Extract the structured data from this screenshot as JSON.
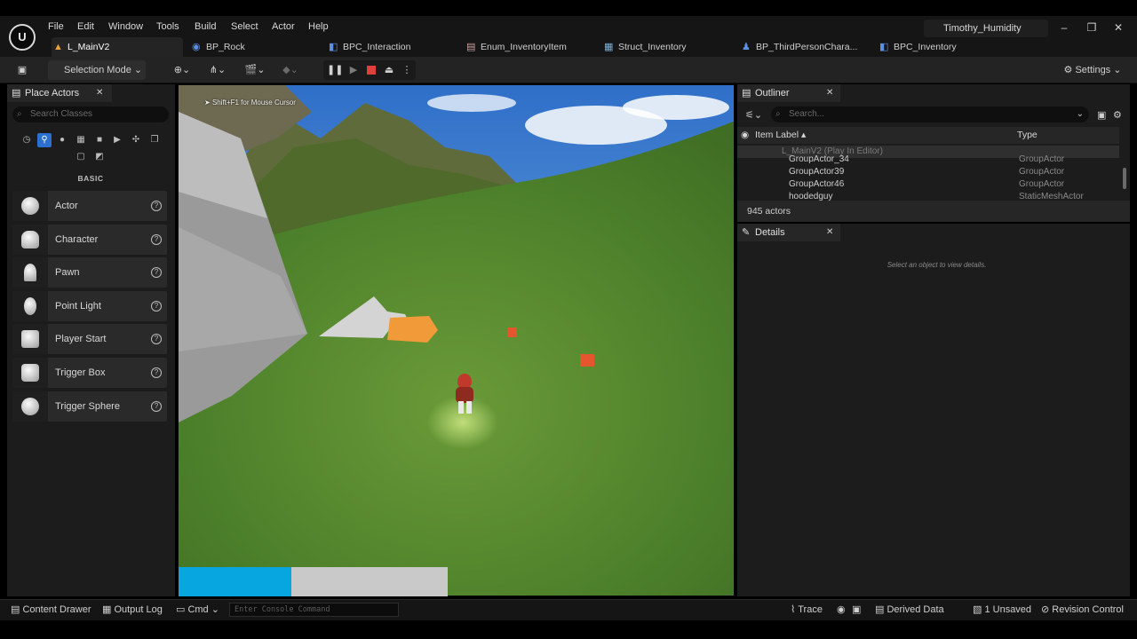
{
  "menu": [
    "File",
    "Edit",
    "Window",
    "Tools",
    "Build",
    "Select",
    "Actor",
    "Help"
  ],
  "user": "Timothy_Humidity",
  "logo_text": "U",
  "tabs": [
    {
      "label": "L_MainV2",
      "icon": "level-icon"
    },
    {
      "label": "BP_Rock",
      "icon": "blueprint-icon"
    },
    {
      "label": "BPC_Interaction",
      "icon": "component-icon"
    },
    {
      "label": "Enum_InventoryItem",
      "icon": "enum-icon"
    },
    {
      "label": "Struct_Inventory",
      "icon": "struct-icon"
    },
    {
      "label": "BP_ThirdPersonChara...",
      "icon": "character-icon"
    },
    {
      "label": "BPC_Inventory",
      "icon": "component-icon"
    }
  ],
  "toolbar": {
    "selection_mode": "Selection Mode",
    "settings": "Settings"
  },
  "place_actors": {
    "title": "Place Actors",
    "search_placeholder": "Search Classes",
    "category": "BASIC",
    "items": [
      "Actor",
      "Character",
      "Pawn",
      "Point Light",
      "Player Start",
      "Trigger Box",
      "Trigger Sphere"
    ]
  },
  "viewport": {
    "hint": "Shift+F1 for Mouse Cursor",
    "health_fraction": 0.42
  },
  "outliner": {
    "title": "Outliner",
    "search_placeholder": "Search...",
    "col_label": "Item Label",
    "col_type": "Type",
    "rows": [
      {
        "name": "L_MainV2 (Play In Editor)",
        "type": ""
      },
      {
        "name": "GroupActor_34",
        "type": "GroupActor"
      },
      {
        "name": "GroupActor39",
        "type": "GroupActor"
      },
      {
        "name": "GroupActor46",
        "type": "GroupActor"
      },
      {
        "name": "hoodedguy",
        "type": "StaticMeshActor"
      }
    ],
    "count": "945 actors"
  },
  "details": {
    "title": "Details",
    "empty": "Select an object to view details."
  },
  "status": {
    "content_drawer": "Content Drawer",
    "output_log": "Output Log",
    "cmd": "Cmd",
    "console_placeholder": "Enter Console Command",
    "trace": "Trace",
    "derived_data": "Derived Data",
    "unsaved": "1 Unsaved",
    "revision_control": "Revision Control"
  },
  "colors": {
    "accent_blue": "#07a6e0",
    "stop_red": "#e0403a",
    "grass": "#4c7f2a"
  }
}
